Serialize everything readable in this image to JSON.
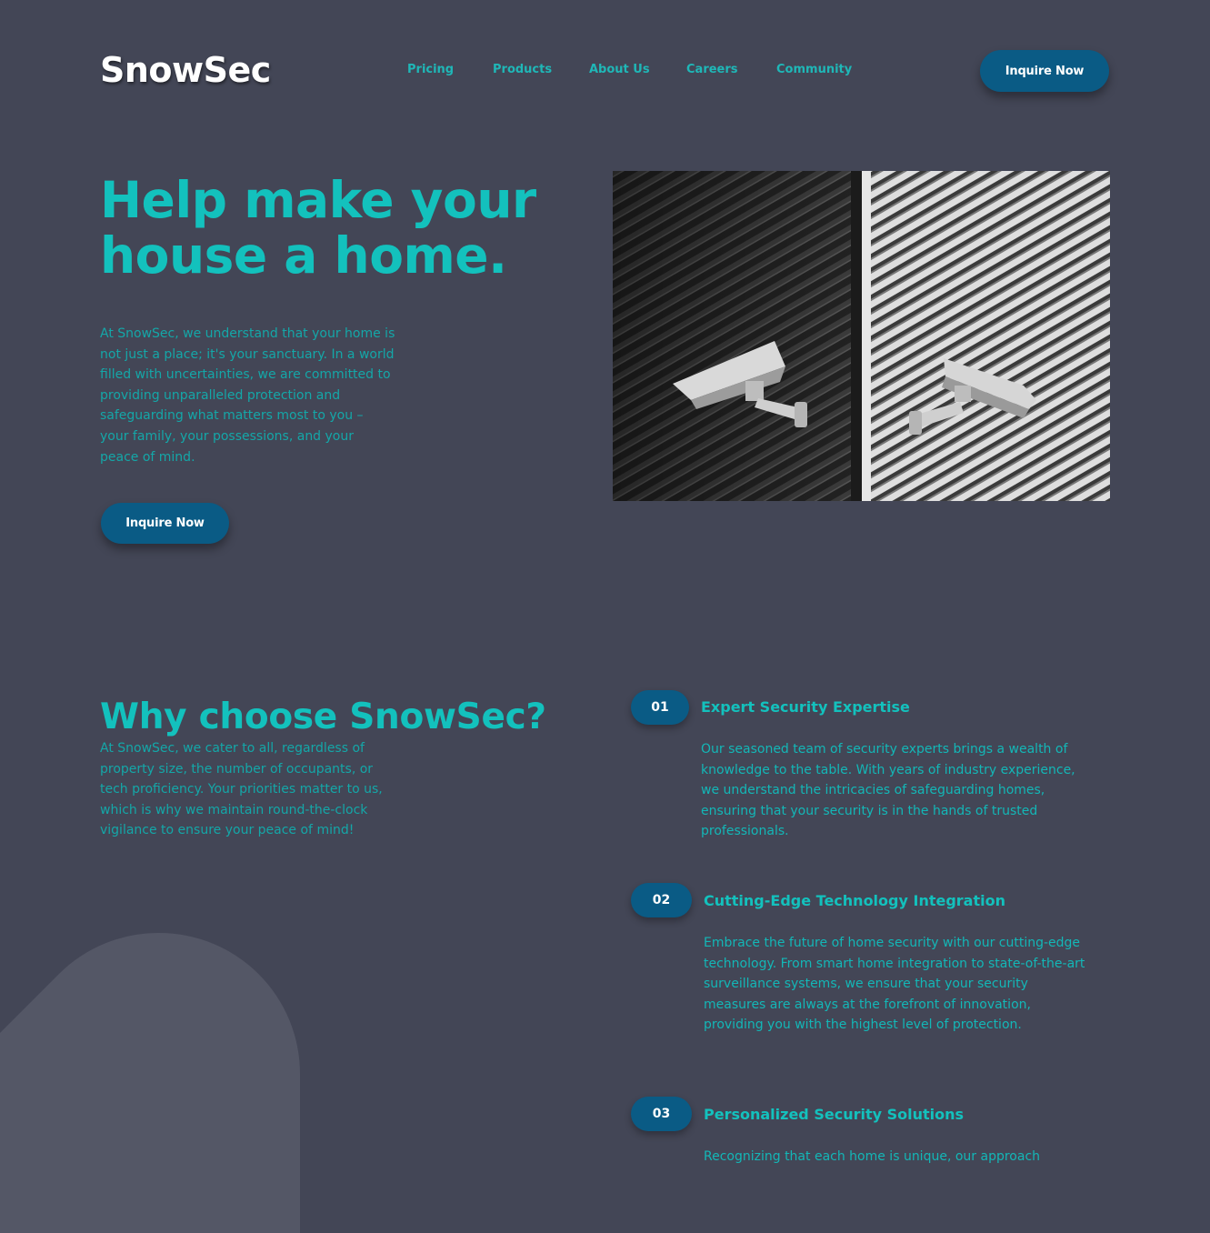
{
  "header": {
    "logo": "SnowSec",
    "nav": [
      "Pricing",
      "Products",
      "About Us",
      "Careers",
      "Community"
    ],
    "cta_label": "Inquire Now"
  },
  "hero": {
    "title_line1": "Help make your",
    "title_line2": "house a home.",
    "text": "At SnowSec, we understand that your home is not just a place; it's your sanctuary. In a world filled with uncertainties, we are committed to providing unparalleled protection and safeguarding what matters most to you – your family, your possessions, and your peace of mind.",
    "cta_label": "Inquire Now"
  },
  "why": {
    "title": "Why choose SnowSec?",
    "text": "At SnowSec, we cater to all, regardless of property size, the number of occupants, or tech proficiency. Your priorities matter to us, which is why we maintain round-the-clock vigilance to ensure your peace of mind!"
  },
  "features": [
    {
      "number": "01",
      "title": "Expert Security Expertise",
      "text": "Our seasoned team of security experts brings a wealth of knowledge to the table. With years of industry experience, we understand the intricacies of safeguarding homes, ensuring that your security is in the hands of trusted professionals."
    },
    {
      "number": "02",
      "title": "Cutting-Edge Technology Integration",
      "text": "Embrace the future of home security with our cutting-edge technology. From smart home integration to state-of-the-art surveillance systems, we ensure that your security measures are always at the forefront of innovation, providing you with the highest level of protection."
    },
    {
      "number": "03",
      "title": "Personalized Security Solutions",
      "text": "Recognizing that each home is unique, our approach"
    }
  ],
  "colors": {
    "background": "#434656",
    "accent": "#13c1bd",
    "button": "#0a5b85",
    "blob": "#545766"
  }
}
